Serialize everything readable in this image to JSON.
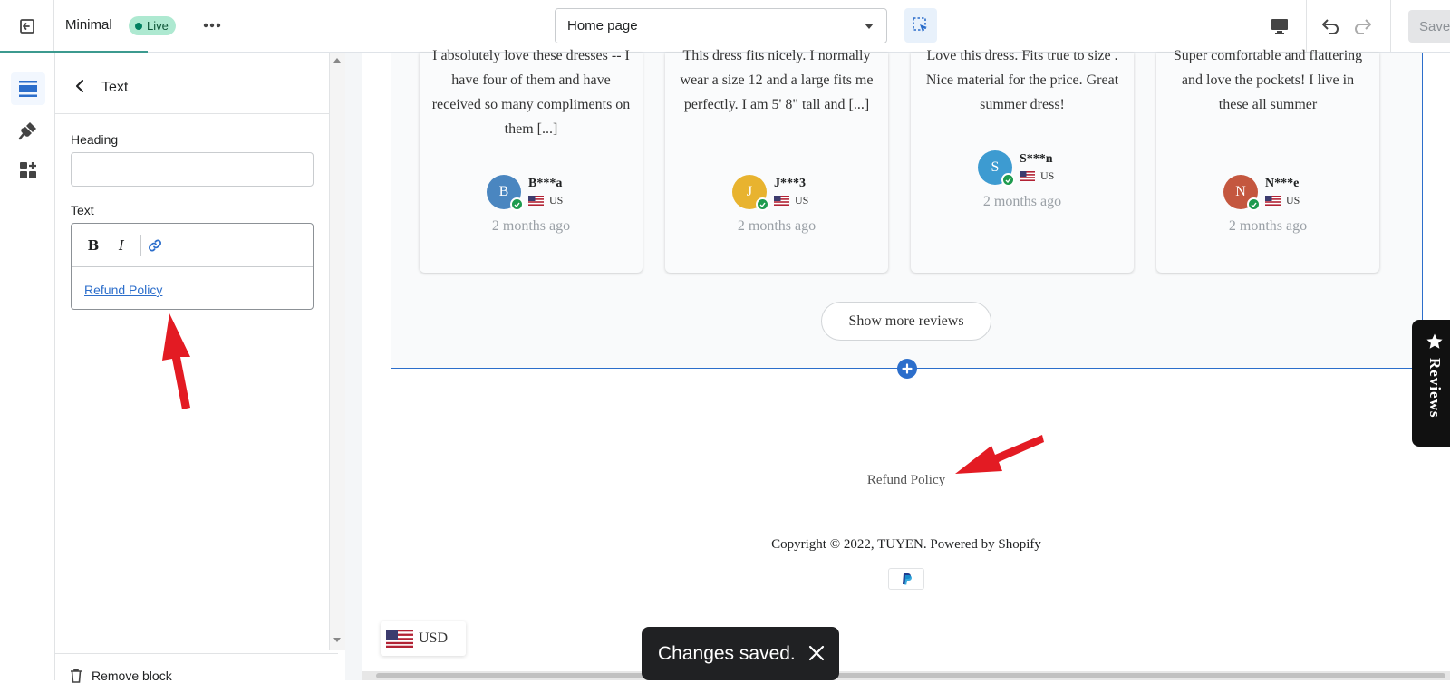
{
  "topbar": {
    "theme_name": "Minimal",
    "live_badge": "Live",
    "page_select_value": "Home page",
    "save_label": "Save"
  },
  "panel": {
    "title": "Text",
    "heading_label": "Heading",
    "heading_value": "",
    "text_label": "Text",
    "rte_bold": "B",
    "rte_italic": "I",
    "rte_content_link": "Refund Policy",
    "remove_block_label": "Remove block"
  },
  "reviews": [
    {
      "text": "I absolutely love these dresses -- I have four of them and have received so many compliments on them [...]",
      "initial": "B",
      "name": "B***a",
      "country": "US",
      "time": "2 months ago",
      "avatar_color": "#4a86c0"
    },
    {
      "text": "This dress fits nicely. I normally wear a size 12 and a large fits me perfectly. I am 5' 8\" tall and [...]",
      "initial": "J",
      "name": "J***3",
      "country": "US",
      "time": "2 months ago",
      "avatar_color": "#e8b32f"
    },
    {
      "text": "Love this dress. Fits true to size . Nice material for the price. Great summer dress!",
      "initial": "S",
      "name": "S***n",
      "country": "US",
      "time": "2 months ago",
      "avatar_color": "#3d9bd1"
    },
    {
      "text": "Super comfortable and flattering and love the pockets! I live in these all summer",
      "initial": "N",
      "name": "N***e",
      "country": "US",
      "time": "2 months ago",
      "avatar_color": "#c4573f"
    }
  ],
  "preview": {
    "show_more_label": "Show more reviews",
    "footer_link": "Refund Policy",
    "copyright": "Copyright © 2022, TUYEN. Powered by Shopify",
    "currency": "USD",
    "reviews_tab": "Reviews"
  },
  "toast": {
    "message": "Changes saved."
  },
  "colors": {
    "accent": "#2c6ecb",
    "live_badge_bg": "#aee9d1",
    "annotation_arrow": "#e31b23",
    "toast_bg": "#202123"
  },
  "icons": [
    "exit-icon",
    "more-icon",
    "chevron-down-icon",
    "inspector-icon",
    "desktop-icon",
    "undo-icon",
    "redo-icon",
    "sections-icon",
    "theme-settings-icon",
    "app-blocks-icon",
    "back-icon",
    "bold-icon",
    "italic-icon",
    "link-icon",
    "trash-icon",
    "plus-icon",
    "star-icon",
    "close-icon",
    "paypal-icon",
    "us-flag-icon"
  ]
}
